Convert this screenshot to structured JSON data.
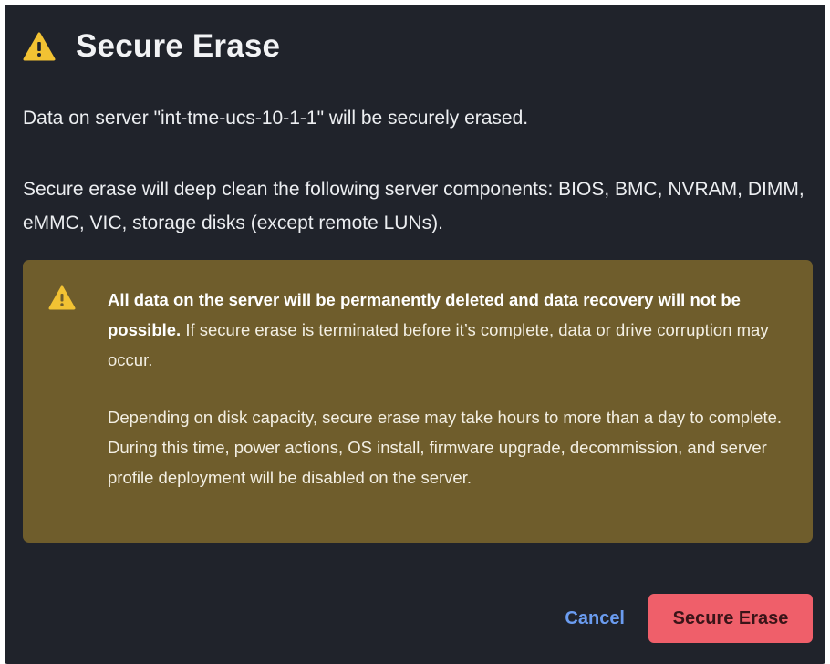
{
  "dialog": {
    "title": "Secure Erase",
    "title_icon": "warning-triangle-icon",
    "server_message": "Data on server \"int-tme-ucs-10-1-1\" will be securely erased.",
    "components_message": "Secure erase will deep clean the following server components: BIOS, BMC, NVRAM, DIMM, eMMC, VIC, storage disks (except remote LUNs)."
  },
  "warning": {
    "icon": "warning-triangle-icon",
    "bold_text": "All data on the server will be permanently deleted and data recovery will not be possible.",
    "text": " If secure erase is terminated before it’s complete, data or drive corruption may occur.",
    "text2": "Depending on disk capacity, secure erase may take hours to more than a day to complete. During this time, power actions, OS install, firmware upgrade, decommission, and server profile deployment will be disabled on the server."
  },
  "buttons": {
    "cancel": "Cancel",
    "confirm": "Secure Erase"
  },
  "colors": {
    "dialog_background": "#20232b",
    "warning_background": "#6f5d2c",
    "warning_icon": "#f2c233",
    "cancel_link": "#6b9cf0",
    "danger_button": "#ef5f6a"
  }
}
